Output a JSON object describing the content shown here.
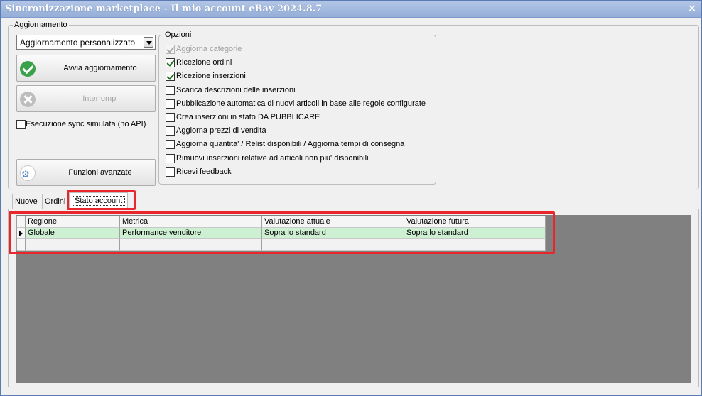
{
  "window": {
    "title": "Sincronizzazione marketplace - Il mio account eBay 2024.8.7",
    "close_glyph": "×"
  },
  "aggiornamento": {
    "legend": "Aggiornamento",
    "mode_select": "Aggiornamento personalizzato",
    "start_button": "Avvia aggiornamento",
    "stop_button": "Interrompi",
    "simulated_sync": {
      "label": "Esecuzione sync simulata (no API)",
      "checked": false
    },
    "advanced_button": "Funzioni avanzate"
  },
  "opzioni": {
    "legend": "Opzioni",
    "items": [
      {
        "label": "Aggiorna categorie",
        "checked": true,
        "disabled": true
      },
      {
        "label": "Ricezione ordini",
        "checked": true,
        "disabled": false
      },
      {
        "label": "Ricezione inserzioni",
        "checked": true,
        "disabled": false
      },
      {
        "label": "Scarica descrizioni delle inserzioni",
        "checked": false,
        "disabled": false
      },
      {
        "label": "Pubblicazione automatica di nuovi articoli in base alle regole configurate",
        "checked": false,
        "disabled": false
      },
      {
        "label": "Crea inserzioni in stato DA PUBBLICARE",
        "checked": false,
        "disabled": false
      },
      {
        "label": "Aggiorna prezzi di vendita",
        "checked": false,
        "disabled": false
      },
      {
        "label": "Aggiorna quantita' / Relist disponibili / Aggiorna tempi di consegna",
        "checked": false,
        "disabled": false
      },
      {
        "label": "Rimuovi inserzioni relative ad articoli non piu' disponibili",
        "checked": false,
        "disabled": false
      },
      {
        "label": "Ricevi feedback",
        "checked": false,
        "disabled": false
      }
    ]
  },
  "tabs": [
    {
      "label": "Nuove",
      "active": false
    },
    {
      "label": "Ordini",
      "active": false
    },
    {
      "label": "Stato account",
      "active": true
    }
  ],
  "grid": {
    "columns": [
      "Regione",
      "Metrica",
      "Valutazione attuale",
      "Valutazione futura"
    ],
    "rows": [
      [
        "Globale",
        "Performance venditore",
        "Sopra lo standard",
        "Sopra lo standard"
      ]
    ]
  },
  "colors": {
    "highlight": "#e8262b",
    "row_selected": "#cdefd2",
    "title_bar": "#9fb6dc"
  }
}
